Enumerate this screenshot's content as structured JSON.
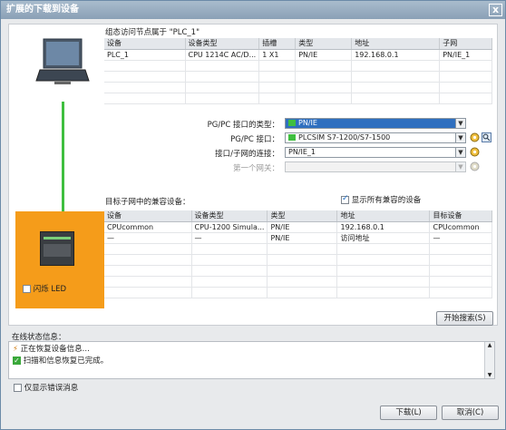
{
  "window": {
    "title": "扩展的下载到设备",
    "close": "x"
  },
  "config_section": {
    "label": "组态访问节点属于 \"PLC_1\"",
    "columns": [
      "设备",
      "设备类型",
      "插槽",
      "类型",
      "地址",
      "子网"
    ],
    "rows": [
      [
        "PLC_1",
        "CPU 1214C AC/D...",
        "1 X1",
        "PN/IE",
        "192.168.0.1",
        "PN/IE_1"
      ]
    ]
  },
  "form": {
    "interface_type_label": "PG/PC 接口的类型：",
    "interface_type_value": "PN/IE",
    "interface_label": "PG/PC 接口：",
    "interface_value": "PLCSIM S7-1200/S7-1500",
    "connection_label": "接口/子网的连接：",
    "connection_value": "PN/IE_1",
    "gateway_label": "第一个网关：",
    "gateway_value": ""
  },
  "target_section": {
    "label": "目标子网中的兼容设备：",
    "show_all_label": "显示所有兼容的设备",
    "show_all_checked": true,
    "columns": [
      "设备",
      "设备类型",
      "类型",
      "地址",
      "目标设备"
    ],
    "rows": [
      [
        "CPUcommon",
        "CPU-1200 Simula...",
        "PN/IE",
        "192.168.0.1",
        "CPUcommon"
      ],
      [
        "—",
        "—",
        "PN/IE",
        "访问地址",
        "—"
      ]
    ]
  },
  "flash_led_label": "闪烁 LED",
  "start_search_label": "开始搜索(S)",
  "online_status_label": "在线状态信息：",
  "status_messages": [
    "正在恢复设备信息...",
    "扫描和信息恢复已完成。"
  ],
  "only_errors_label": "仅显示错误消息",
  "download_label": "下载(L)",
  "cancel_label": "取消(C)",
  "colors": {
    "accent": "#2f6fbf",
    "orange": "#f59c1a",
    "link": "#3fbf3f"
  }
}
